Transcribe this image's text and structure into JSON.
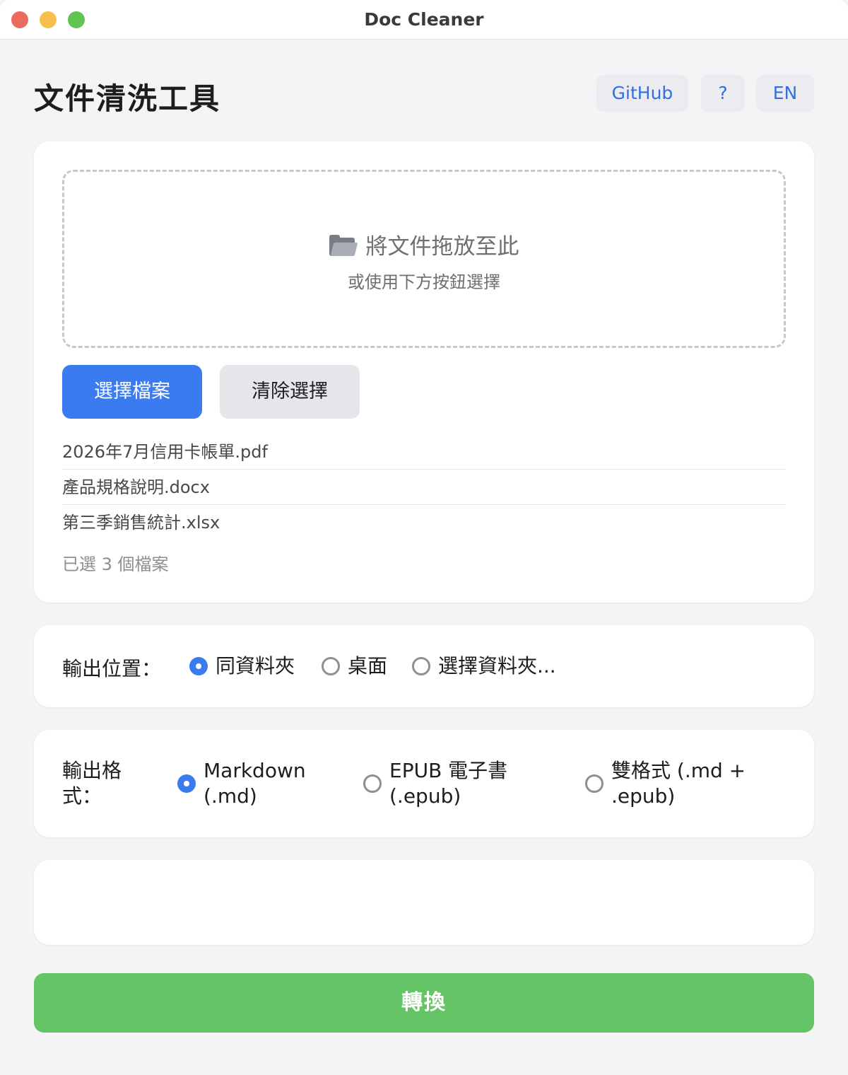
{
  "window": {
    "title": "Doc Cleaner"
  },
  "header": {
    "title": "文件清洗工具",
    "github_label": "GitHub",
    "help_label": "?",
    "lang_label": "EN"
  },
  "dropzone": {
    "icon": "folder-icon",
    "title": "將文件拖放至此",
    "subtitle": "或使用下方按鈕選擇"
  },
  "actions": {
    "choose_label": "選擇檔案",
    "clear_label": "清除選擇"
  },
  "files": [
    "2026年7月信用卡帳單.pdf",
    "產品規格說明.docx",
    "第三季銷售統計.xlsx"
  ],
  "file_count": "已選 3 個檔案",
  "output_location": {
    "label": "輸出位置：",
    "options": [
      "同資料夾",
      "桌面",
      "選擇資料夾..."
    ],
    "selected": "同資料夾"
  },
  "output_format": {
    "label": "輸出格式：",
    "options": [
      "Markdown (.md)",
      "EPUB 電子書 (.epub)",
      "雙格式 (.md + .epub)"
    ],
    "selected": "Markdown (.md)"
  },
  "convert_label": "轉換",
  "colors": {
    "accent": "#3a7bf0",
    "convert": "#64c466",
    "link": "#2f6fe0"
  }
}
